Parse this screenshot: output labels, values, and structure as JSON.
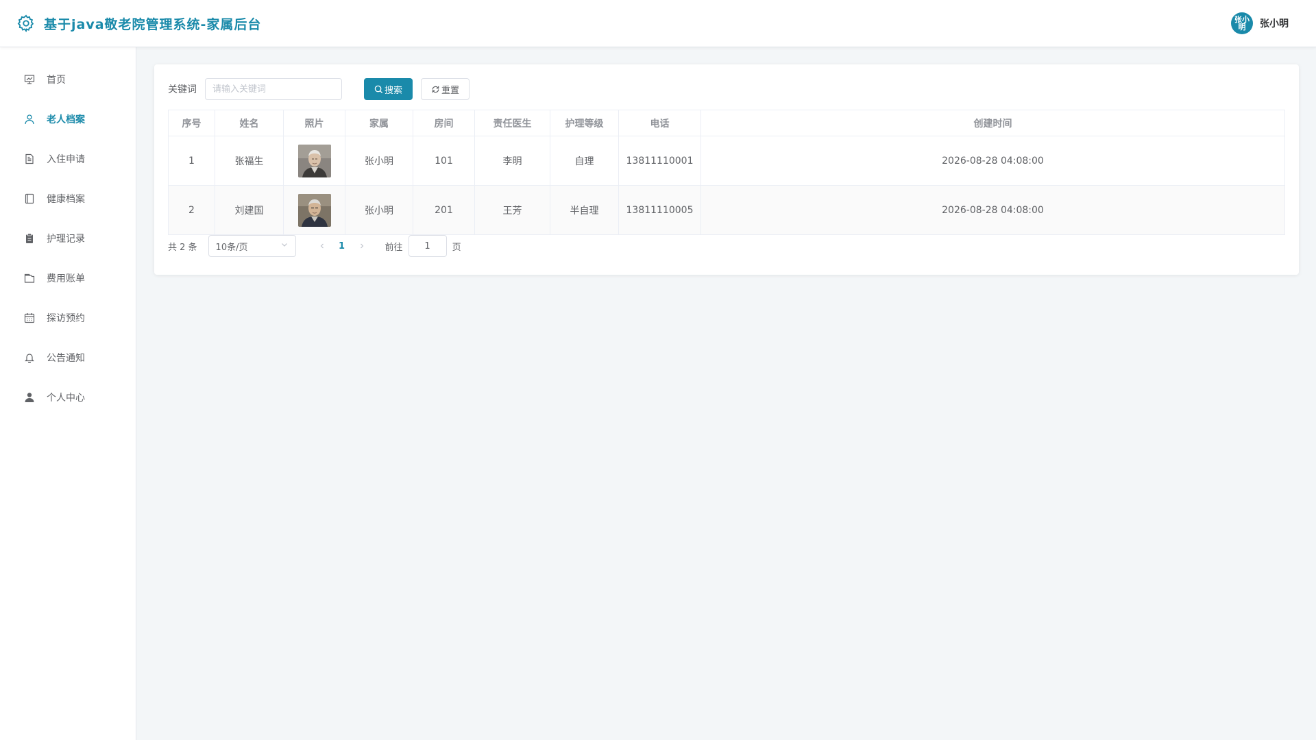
{
  "header": {
    "title": "基于java敬老院管理系统-家属后台",
    "avatar_text": "张小明",
    "user_name": "张小明",
    "accent_color": "#1a8aaa"
  },
  "sidebar": {
    "items": [
      {
        "label": "首页",
        "icon": "presentation-icon",
        "active": false
      },
      {
        "label": "老人档案",
        "icon": "user-icon",
        "active": true
      },
      {
        "label": "入住申请",
        "icon": "document-icon",
        "active": false
      },
      {
        "label": "健康档案",
        "icon": "notebook-icon",
        "active": false
      },
      {
        "label": "护理记录",
        "icon": "clipboard-icon",
        "active": false
      },
      {
        "label": "费用账单",
        "icon": "wallet-icon",
        "active": false
      },
      {
        "label": "探访预约",
        "icon": "calendar-icon",
        "active": false
      },
      {
        "label": "公告通知",
        "icon": "bell-icon",
        "active": false
      },
      {
        "label": "个人中心",
        "icon": "person-icon",
        "active": false
      }
    ]
  },
  "search": {
    "label": "关键词",
    "placeholder": "请输入关键词",
    "value": "",
    "search_button": "搜索",
    "reset_button": "重置"
  },
  "table": {
    "columns": [
      "序号",
      "姓名",
      "照片",
      "家属",
      "房间",
      "责任医生",
      "护理等级",
      "电话",
      "创建时间"
    ],
    "rows": [
      {
        "index": "1",
        "name": "张福生",
        "photo": "elderly-man-photo",
        "family": "张小明",
        "room": "101",
        "doctor": "李明",
        "care_level": "自理",
        "phone": "13811110001",
        "created": "2026-08-28 04:08:00"
      },
      {
        "index": "2",
        "name": "刘建国",
        "photo": "elderly-man-photo",
        "family": "张小明",
        "room": "201",
        "doctor": "王芳",
        "care_level": "半自理",
        "phone": "13811110005",
        "created": "2026-08-28 04:08:00"
      }
    ]
  },
  "pagination": {
    "total_text": "共 2 条",
    "page_size": "10条/页",
    "current_page": "1",
    "goto_label": "前往",
    "goto_value": "1",
    "page_suffix": "页"
  }
}
